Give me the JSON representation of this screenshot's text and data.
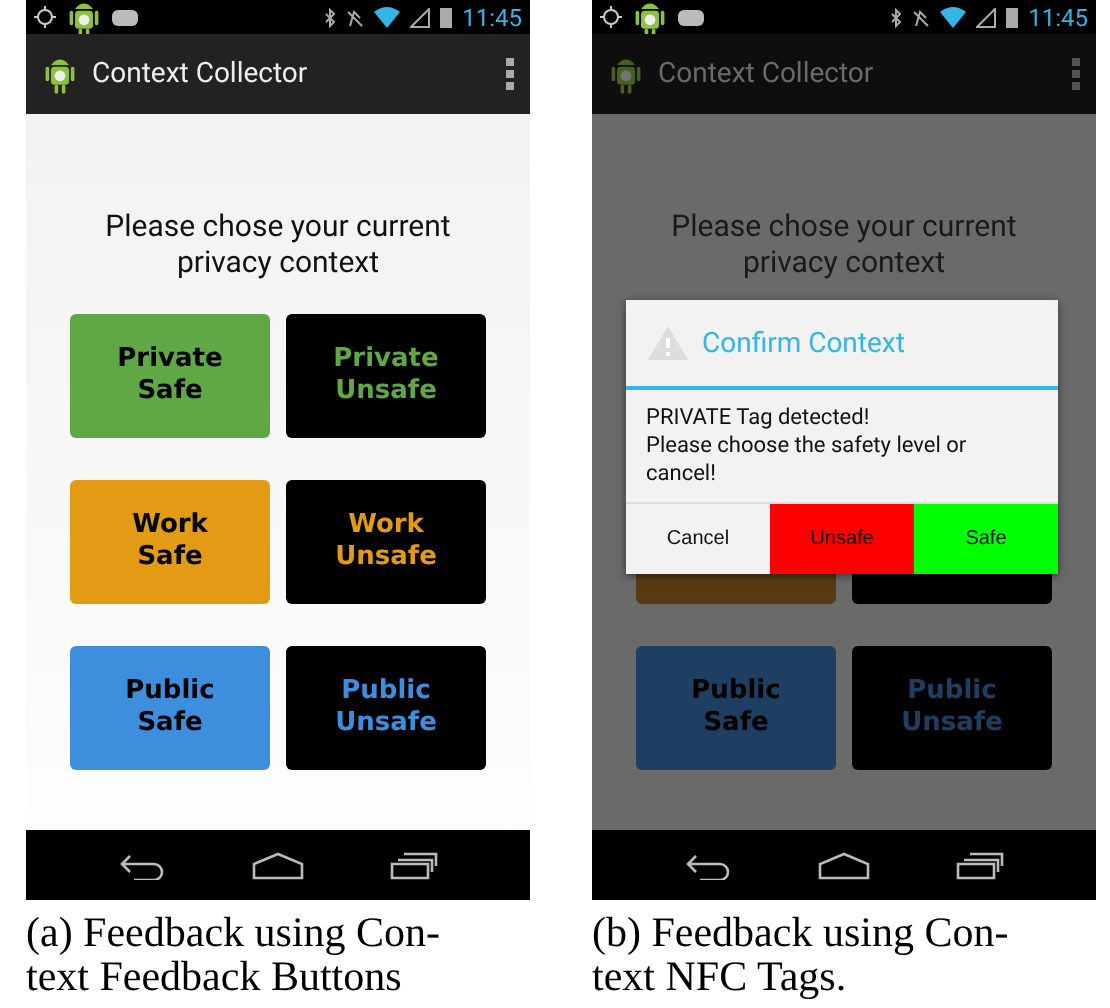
{
  "phones": [
    {
      "status_bar": {
        "time": "11:45"
      },
      "app_bar": {
        "title": "Context Collector"
      },
      "heading": "Please chose your current privacy context",
      "dimmed": false,
      "rows": [
        {
          "color": "#5fa845",
          "buttons": [
            {
              "kind": "safe",
              "label": "Private\nSafe"
            },
            {
              "kind": "unsafe",
              "label": "Private\nUnsafe"
            }
          ]
        },
        {
          "color": "#e39a14",
          "buttons": [
            {
              "kind": "safe",
              "label": "Work\nSafe"
            },
            {
              "kind": "unsafe",
              "label": "Work\nUnsafe"
            }
          ]
        },
        {
          "color": "#3d8fde",
          "buttons": [
            {
              "kind": "safe",
              "label": "Public\nSafe"
            },
            {
              "kind": "unsafe",
              "label": "Public\nUnsafe"
            }
          ]
        }
      ],
      "caption": [
        "(a) Feedback using Con-",
        "text Feedback Buttons"
      ]
    },
    {
      "status_bar": {
        "time": "11:45"
      },
      "app_bar": {
        "title": "Context Collector"
      },
      "heading": "Please chose your current privacy context",
      "dimmed": true,
      "rows": [
        {
          "color": "#573a12",
          "buttons": [
            {
              "kind": "safe"
            },
            {
              "kind": "unsafe"
            }
          ]
        },
        {
          "color": "#1f3f62",
          "buttons": [
            {
              "kind": "safe",
              "label": "Public\nSafe"
            },
            {
              "kind": "unsafe",
              "label": "Public\nUnsafe"
            }
          ]
        }
      ],
      "dialog": {
        "title": "Confirm Context",
        "message": [
          "PRIVATE Tag detected!",
          "Please choose the safety level or",
          "cancel!"
        ],
        "buttons": [
          {
            "label": "Cancel",
            "color": "#f2f2f2"
          },
          {
            "label": "Unsafe",
            "color": "#ff0000"
          },
          {
            "label": "Safe",
            "color": "#00ff00"
          }
        ]
      },
      "caption": [
        "(b) Feedback using Con-",
        "text NFC Tags."
      ]
    }
  ]
}
